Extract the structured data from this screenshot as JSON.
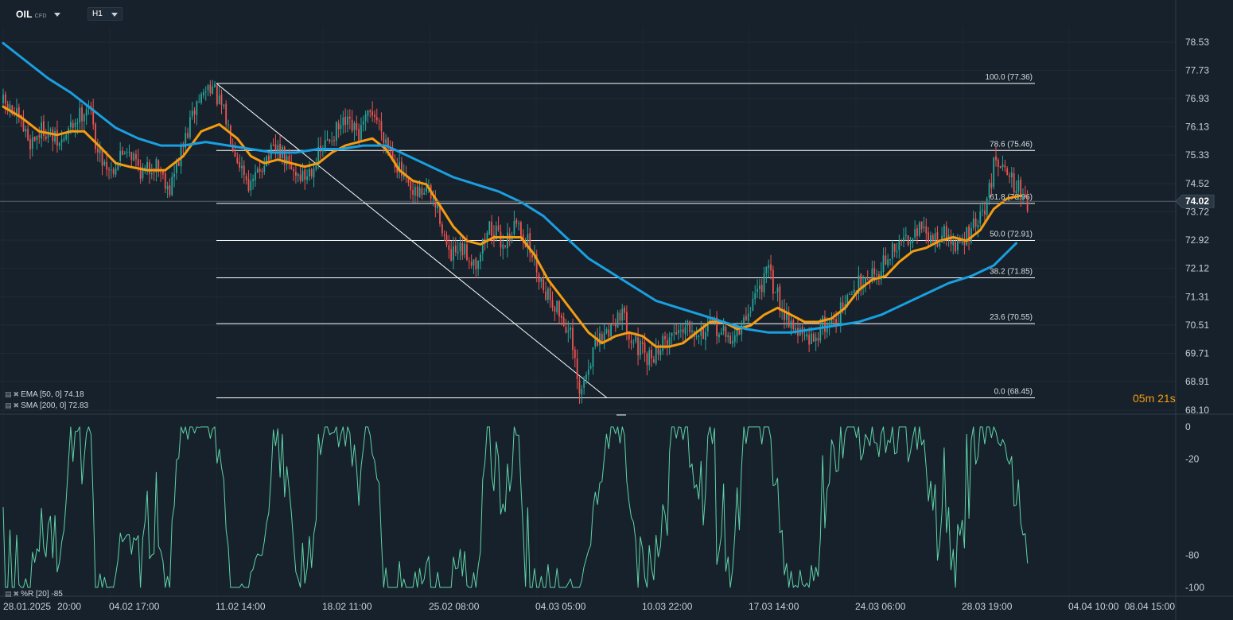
{
  "toolbar": {
    "symbol": "OIL",
    "symbol_sub": "CFD",
    "timeframe": "H1"
  },
  "colors": {
    "background": "#17212b",
    "candle_up": "#26a69a",
    "candle_down": "#ef5350",
    "ema": "#f39c12",
    "sma": "#1a9fe0",
    "williams": "#5fd3a8",
    "fib": "#ffffff"
  },
  "legend": {
    "ema": "EMA [50, 0] 74.18",
    "sma": "SMA [200, 0] 72.83",
    "wr": "%R [20] -85"
  },
  "countdown": {
    "minutes": "05",
    "m_unit": "m",
    "seconds": "21",
    "s_unit": "s"
  },
  "chart_data": [
    {
      "type": "candlestick",
      "instrument": "OIL",
      "timeframe": "H1",
      "ylim": [
        68.1,
        78.53
      ],
      "y_ticks": [
        "78.53",
        "77.73",
        "76.93",
        "76.13",
        "75.33",
        "74.52",
        "73.72",
        "72.92",
        "72.12",
        "71.31",
        "70.51",
        "69.71",
        "68.91",
        "68.10"
      ],
      "current_price": "74.02",
      "x_ticks": [
        "28.01.2025",
        "20:00",
        "04.02 17:00",
        "11.02 14:00",
        "18.02 11:00",
        "25.02 08:00",
        "04.03 05:00",
        "10.03 22:00",
        "17.03 14:00",
        "24.03 06:00",
        "28.03 19:00",
        "04.04 10:00",
        "08.04 15:00"
      ],
      "price_path": [
        [
          0,
          76.8
        ],
        [
          6,
          76.4
        ],
        [
          12,
          75.7
        ],
        [
          18,
          76.1
        ],
        [
          25,
          75.6
        ],
        [
          32,
          76.3
        ],
        [
          38,
          76.8
        ],
        [
          42,
          75.4
        ],
        [
          48,
          74.9
        ],
        [
          55,
          75.6
        ],
        [
          62,
          74.8
        ],
        [
          68,
          75.1
        ],
        [
          74,
          74.4
        ],
        [
          80,
          75.6
        ],
        [
          86,
          76.8
        ],
        [
          92,
          77.36
        ],
        [
          98,
          76.5
        ],
        [
          104,
          75.3
        ],
        [
          110,
          74.4
        ],
        [
          116,
          75.2
        ],
        [
          122,
          75.5
        ],
        [
          128,
          74.9
        ],
        [
          134,
          74.7
        ],
        [
          140,
          75.3
        ],
        [
          146,
          75.9
        ],
        [
          152,
          76.2
        ],
        [
          158,
          75.9
        ],
        [
          164,
          76.6
        ],
        [
          170,
          75.8
        ],
        [
          176,
          74.9
        ],
        [
          182,
          74.1
        ],
        [
          188,
          74.4
        ],
        [
          194,
          73.6
        ],
        [
          198,
          72.4
        ],
        [
          204,
          72.6
        ],
        [
          210,
          72.3
        ],
        [
          216,
          73.3
        ],
        [
          222,
          72.8
        ],
        [
          228,
          73.4
        ],
        [
          234,
          72.7
        ],
        [
          240,
          71.6
        ],
        [
          246,
          71.0
        ],
        [
          252,
          70.2
        ],
        [
          256,
          68.45
        ],
        [
          262,
          69.8
        ],
        [
          268,
          70.3
        ],
        [
          274,
          70.9
        ],
        [
          280,
          70.1
        ],
        [
          286,
          69.5
        ],
        [
          292,
          69.9
        ],
        [
          298,
          70.3
        ],
        [
          304,
          70.6
        ],
        [
          310,
          70.3
        ],
        [
          316,
          70.5
        ],
        [
          322,
          70.1
        ],
        [
          328,
          70.4
        ],
        [
          334,
          71.4
        ],
        [
          340,
          72.0
        ],
        [
          346,
          71.0
        ],
        [
          352,
          70.4
        ],
        [
          358,
          70.0
        ],
        [
          364,
          70.5
        ],
        [
          370,
          70.7
        ],
        [
          376,
          71.3
        ],
        [
          382,
          71.9
        ],
        [
          388,
          72.0
        ],
        [
          394,
          72.5
        ],
        [
          400,
          72.9
        ],
        [
          406,
          73.3
        ],
        [
          412,
          72.9
        ],
        [
          418,
          73.1
        ],
        [
          424,
          72.7
        ],
        [
          430,
          73.2
        ],
        [
          436,
          73.7
        ],
        [
          440,
          75.0
        ],
        [
          444,
          75.3
        ],
        [
          448,
          74.6
        ],
        [
          452,
          74.3
        ],
        [
          455,
          74.0
        ]
      ],
      "series": [
        {
          "name": "EMA [50, 0]",
          "last_value": 74.18,
          "points": [
            [
              0,
              76.7
            ],
            [
              8,
              76.4
            ],
            [
              16,
              76.0
            ],
            [
              24,
              75.9
            ],
            [
              30,
              76.0
            ],
            [
              36,
              76.0
            ],
            [
              44,
              75.5
            ],
            [
              50,
              75.1
            ],
            [
              56,
              75.0
            ],
            [
              64,
              74.9
            ],
            [
              72,
              74.9
            ],
            [
              80,
              75.3
            ],
            [
              88,
              76.0
            ],
            [
              96,
              76.2
            ],
            [
              104,
              75.8
            ],
            [
              110,
              75.3
            ],
            [
              116,
              75.1
            ],
            [
              122,
              75.2
            ],
            [
              128,
              75.1
            ],
            [
              134,
              75.0
            ],
            [
              140,
              75.1
            ],
            [
              146,
              75.4
            ],
            [
              152,
              75.6
            ],
            [
              158,
              75.7
            ],
            [
              164,
              75.8
            ],
            [
              170,
              75.5
            ],
            [
              176,
              74.9
            ],
            [
              182,
              74.6
            ],
            [
              188,
              74.5
            ],
            [
              194,
              73.9
            ],
            [
              200,
              73.3
            ],
            [
              206,
              72.9
            ],
            [
              212,
              72.8
            ],
            [
              218,
              73.0
            ],
            [
              224,
              73.0
            ],
            [
              230,
              73.0
            ],
            [
              236,
              72.5
            ],
            [
              242,
              71.8
            ],
            [
              248,
              71.3
            ],
            [
              254,
              70.8
            ],
            [
              260,
              70.3
            ],
            [
              266,
              70.0
            ],
            [
              272,
              70.2
            ],
            [
              278,
              70.3
            ],
            [
              284,
              70.2
            ],
            [
              290,
              69.9
            ],
            [
              296,
              69.9
            ],
            [
              302,
              70.0
            ],
            [
              308,
              70.3
            ],
            [
              314,
              70.6
            ],
            [
              320,
              70.6
            ],
            [
              326,
              70.4
            ],
            [
              332,
              70.5
            ],
            [
              338,
              70.8
            ],
            [
              344,
              71.0
            ],
            [
              350,
              70.8
            ],
            [
              356,
              70.6
            ],
            [
              362,
              70.6
            ],
            [
              368,
              70.7
            ],
            [
              374,
              71.0
            ],
            [
              380,
              71.5
            ],
            [
              386,
              71.8
            ],
            [
              392,
              71.9
            ],
            [
              398,
              72.3
            ],
            [
              404,
              72.6
            ],
            [
              410,
              72.7
            ],
            [
              416,
              72.9
            ],
            [
              422,
              73.0
            ],
            [
              428,
              72.9
            ],
            [
              434,
              73.2
            ],
            [
              440,
              73.8
            ],
            [
              446,
              74.1
            ],
            [
              452,
              74.18
            ]
          ]
        },
        {
          "name": "SMA [200, 0]",
          "last_value": 72.83,
          "points": [
            [
              0,
              78.5
            ],
            [
              10,
              78.0
            ],
            [
              20,
              77.5
            ],
            [
              30,
              77.1
            ],
            [
              40,
              76.6
            ],
            [
              50,
              76.1
            ],
            [
              60,
              75.8
            ],
            [
              70,
              75.6
            ],
            [
              80,
              75.6
            ],
            [
              90,
              75.7
            ],
            [
              100,
              75.6
            ],
            [
              110,
              75.5
            ],
            [
              120,
              75.4
            ],
            [
              130,
              75.4
            ],
            [
              140,
              75.5
            ],
            [
              150,
              75.5
            ],
            [
              160,
              75.6
            ],
            [
              170,
              75.6
            ],
            [
              180,
              75.3
            ],
            [
              190,
              75.0
            ],
            [
              200,
              74.7
            ],
            [
              210,
              74.5
            ],
            [
              220,
              74.3
            ],
            [
              230,
              74.0
            ],
            [
              240,
              73.6
            ],
            [
              250,
              73.0
            ],
            [
              260,
              72.4
            ],
            [
              270,
              72.0
            ],
            [
              280,
              71.6
            ],
            [
              290,
              71.2
            ],
            [
              300,
              71.0
            ],
            [
              310,
              70.8
            ],
            [
              320,
              70.6
            ],
            [
              330,
              70.4
            ],
            [
              340,
              70.3
            ],
            [
              350,
              70.3
            ],
            [
              360,
              70.4
            ],
            [
              370,
              70.5
            ],
            [
              380,
              70.6
            ],
            [
              390,
              70.8
            ],
            [
              400,
              71.1
            ],
            [
              410,
              71.4
            ],
            [
              420,
              71.7
            ],
            [
              430,
              71.9
            ],
            [
              440,
              72.2
            ],
            [
              450,
              72.83
            ]
          ]
        }
      ],
      "fibonacci": [
        {
          "label": "100.0 (77.36)",
          "level": 77.36
        },
        {
          "label": "78.6 (75.46)",
          "level": 75.46
        },
        {
          "label": "61.8 (73.96)",
          "level": 73.96
        },
        {
          "label": "50.0 (72.91)",
          "level": 72.91
        },
        {
          "label": "38.2 (71.85)",
          "level": 71.85
        },
        {
          "label": "23.6 (70.55)",
          "level": 70.55
        },
        {
          "label": "0.0 (68.45)",
          "level": 68.45
        }
      ],
      "fib_range": {
        "high": 77.36,
        "low": 68.45
      }
    },
    {
      "type": "line",
      "name": "%R [20]",
      "last_value": -85,
      "ylim": [
        -100,
        0
      ],
      "y_ticks": [
        "0",
        "-20",
        "-80",
        "-100"
      ]
    }
  ]
}
